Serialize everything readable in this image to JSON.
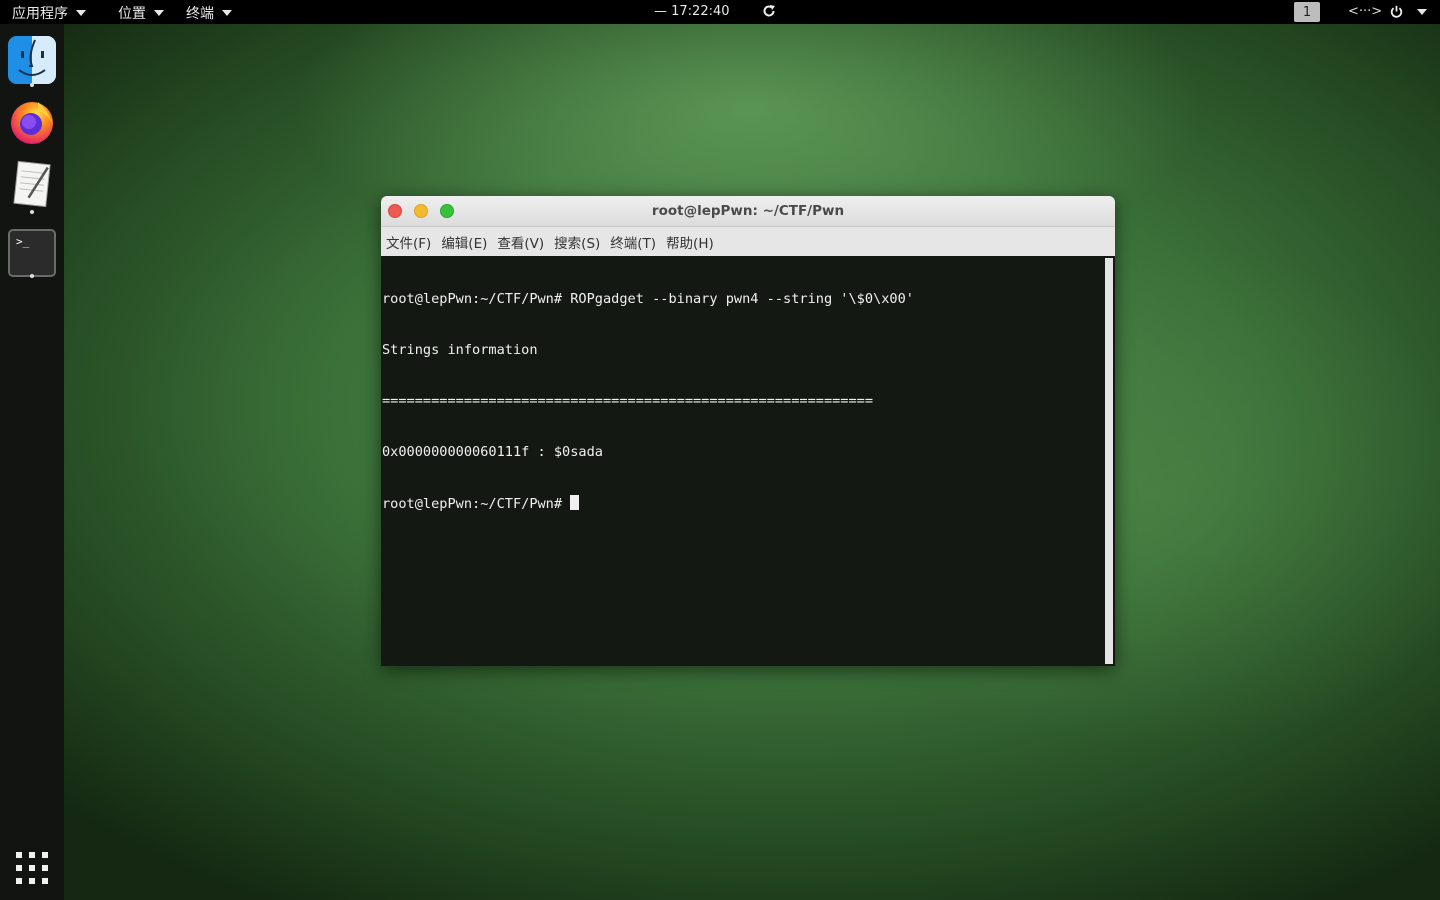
{
  "topbar": {
    "menu_apps": "应用程序",
    "menu_places": "位置",
    "menu_terminal": "终端",
    "clock": "— 17:22:40",
    "workspace": "1",
    "network_label": "<···>"
  },
  "dock": {
    "items": [
      "finder-icon",
      "firefox-icon",
      "notes-icon",
      "terminal-icon"
    ],
    "terminal_prompt_glyph": ">_",
    "show_apps": "grid-icon"
  },
  "window": {
    "title": "root@lepPwn: ~/CTF/Pwn",
    "menu": [
      "文件(F)",
      "编辑(E)",
      "查看(V)",
      "搜索(S)",
      "终端(T)",
      "帮助(H)"
    ],
    "lines": [
      "root@lepPwn:~/CTF/Pwn# ROPgadget --binary pwn4 --string '\\$0\\x00'",
      "Strings information",
      "============================================================",
      "0x000000000060111f : $0sada"
    ],
    "prompt": "root@lepPwn:~/CTF/Pwn# "
  },
  "colors": {
    "terminal_bg": "#141812",
    "close": "#ed5a50",
    "minimize": "#f3ba2f",
    "maximize": "#38c23c"
  }
}
